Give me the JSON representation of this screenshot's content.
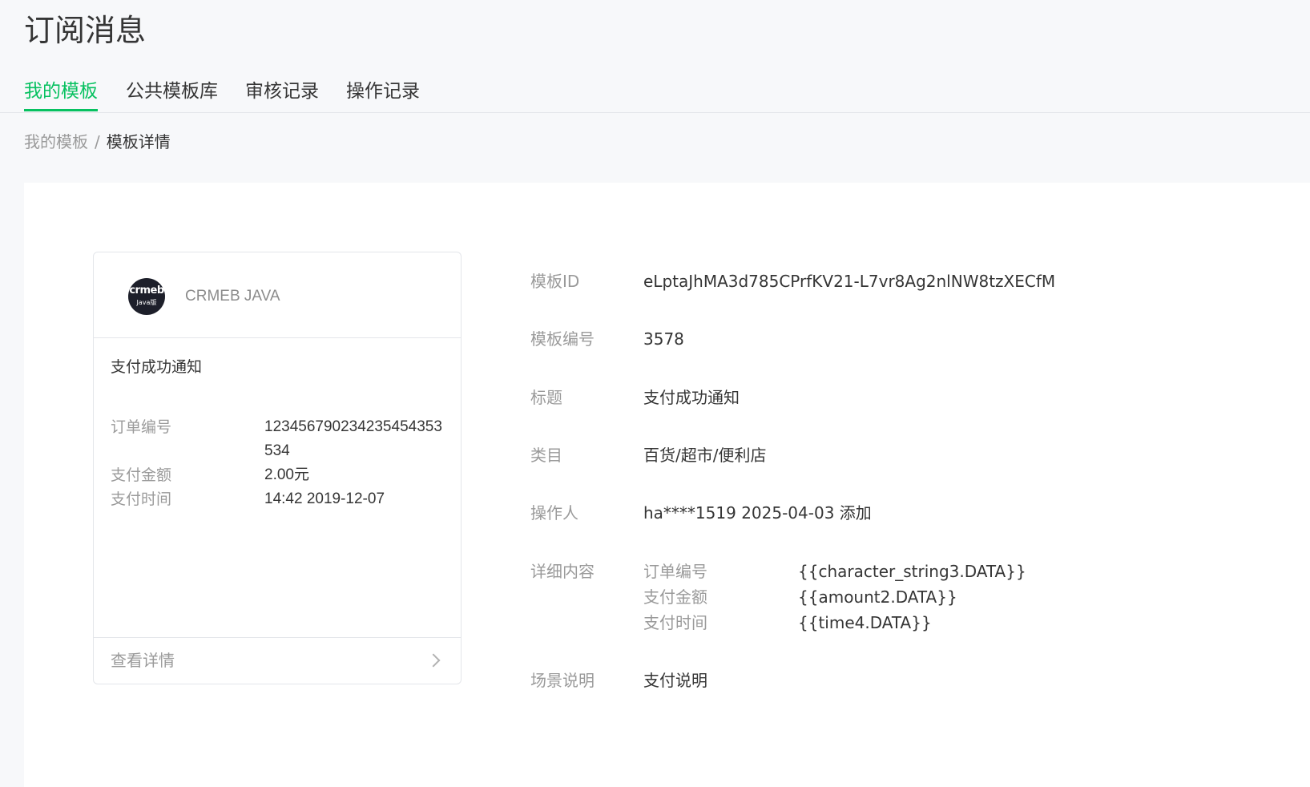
{
  "page": {
    "title": "订阅消息"
  },
  "tabs": [
    {
      "label": "我的模板",
      "active": true
    },
    {
      "label": "公共模板库",
      "active": false
    },
    {
      "label": "审核记录",
      "active": false
    },
    {
      "label": "操作记录",
      "active": false
    }
  ],
  "breadcrumb": {
    "parent": "我的模板",
    "separator": "/",
    "current": "模板详情"
  },
  "preview": {
    "account_name": "CRMEB JAVA",
    "logo_text_top": "crmeb",
    "logo_text_bottom": "Java版",
    "title": "支付成功通知",
    "rows": [
      {
        "key": "订单编号",
        "value": "123456790234235454353534"
      },
      {
        "key": "支付金额",
        "value": "2.00元"
      },
      {
        "key": "支付时间",
        "value": "14:42 2019-12-07"
      }
    ],
    "footer_label": "查看详情"
  },
  "details": {
    "template_id": {
      "key": "模板ID",
      "value": "eLptaJhMA3d785CPrfKV21-L7vr8Ag2nlNW8tzXECfM"
    },
    "template_no": {
      "key": "模板编号",
      "value": "3578"
    },
    "title": {
      "key": "标题",
      "value": "支付成功通知"
    },
    "category": {
      "key": "类目",
      "value": "百货/超市/便利店"
    },
    "operator": {
      "key": "操作人",
      "value": "ha****1519 2025-04-03 添加"
    },
    "content": {
      "key": "详细内容",
      "items": [
        {
          "key": "订单编号",
          "value": "{{character_string3.DATA}}"
        },
        {
          "key": "支付金额",
          "value": "{{amount2.DATA}}"
        },
        {
          "key": "支付时间",
          "value": "{{time4.DATA}}"
        }
      ]
    },
    "scene": {
      "key": "场景说明",
      "value": "支付说明"
    }
  },
  "colors": {
    "accent": "#07c160",
    "background": "#f7f8fa",
    "text": "#353535",
    "muted": "#9a9a9a"
  }
}
